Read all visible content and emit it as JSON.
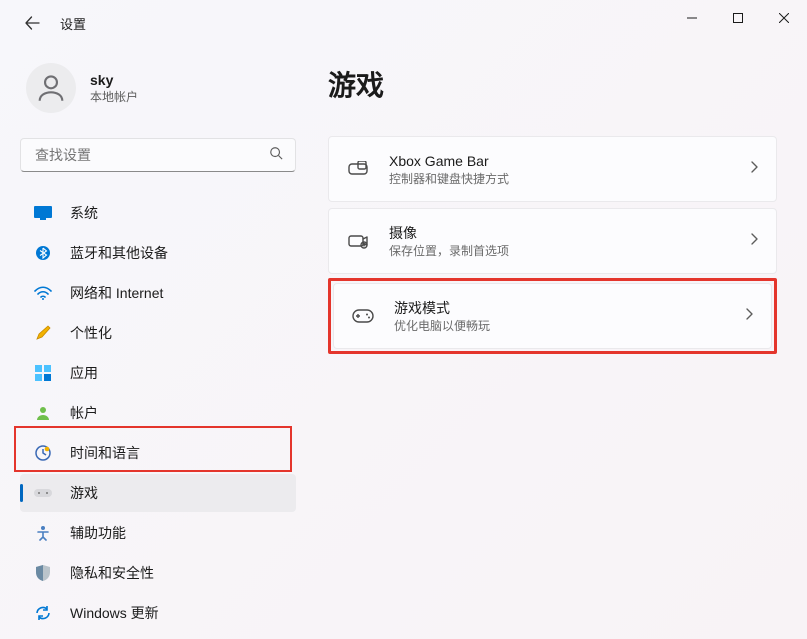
{
  "app_title": "设置",
  "account": {
    "name": "sky",
    "sub": "本地帐户"
  },
  "search": {
    "placeholder": "查找设置"
  },
  "nav": [
    {
      "label": "系统",
      "icon": "system"
    },
    {
      "label": "蓝牙和其他设备",
      "icon": "bt"
    },
    {
      "label": "网络和 Internet",
      "icon": "wifi"
    },
    {
      "label": "个性化",
      "icon": "brush"
    },
    {
      "label": "应用",
      "icon": "apps"
    },
    {
      "label": "帐户",
      "icon": "person"
    },
    {
      "label": "时间和语言",
      "icon": "time"
    },
    {
      "label": "游戏",
      "icon": "game",
      "selected": true
    },
    {
      "label": "辅助功能",
      "icon": "access"
    },
    {
      "label": "隐私和安全性",
      "icon": "shield"
    },
    {
      "label": "Windows 更新",
      "icon": "update"
    }
  ],
  "page": {
    "title": "游戏"
  },
  "cards": [
    {
      "title": "Xbox Game Bar",
      "sub": "控制器和键盘快捷方式",
      "icon": "xbox"
    },
    {
      "title": "摄像",
      "sub": "保存位置，录制首选项",
      "icon": "capture"
    },
    {
      "title": "游戏模式",
      "sub": "优化电脑以便畅玩",
      "icon": "mode",
      "highlight": true
    }
  ]
}
